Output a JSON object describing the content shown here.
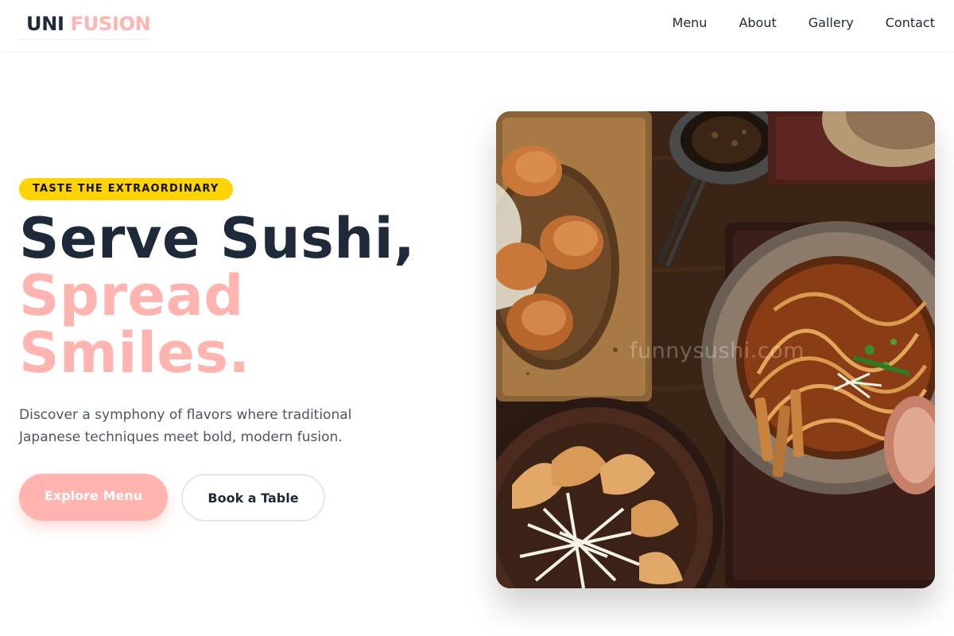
{
  "header": {
    "logo": {
      "part1": "UNI",
      "part2": "FUSION"
    },
    "nav": [
      "Menu",
      "About",
      "Gallery",
      "Contact"
    ]
  },
  "hero": {
    "badge": "TASTE THE EXTRAORDINARY",
    "headline": {
      "line1": "Serve Sushi,",
      "line2": "Spread",
      "line3": "Smiles."
    },
    "description": "Discover a symphony of flavors where traditional Japanese techniques meet bold, modern fusion.",
    "primary_cta": "Explore Menu",
    "secondary_cta": "Book a Table",
    "image": {
      "watermark": "funnysushi.com"
    }
  },
  "colors": {
    "brand_dark": "#1e2939",
    "brand_pink": "#ffb4b0",
    "badge_yellow": "#ffd400",
    "body_text": "#4b5563"
  }
}
